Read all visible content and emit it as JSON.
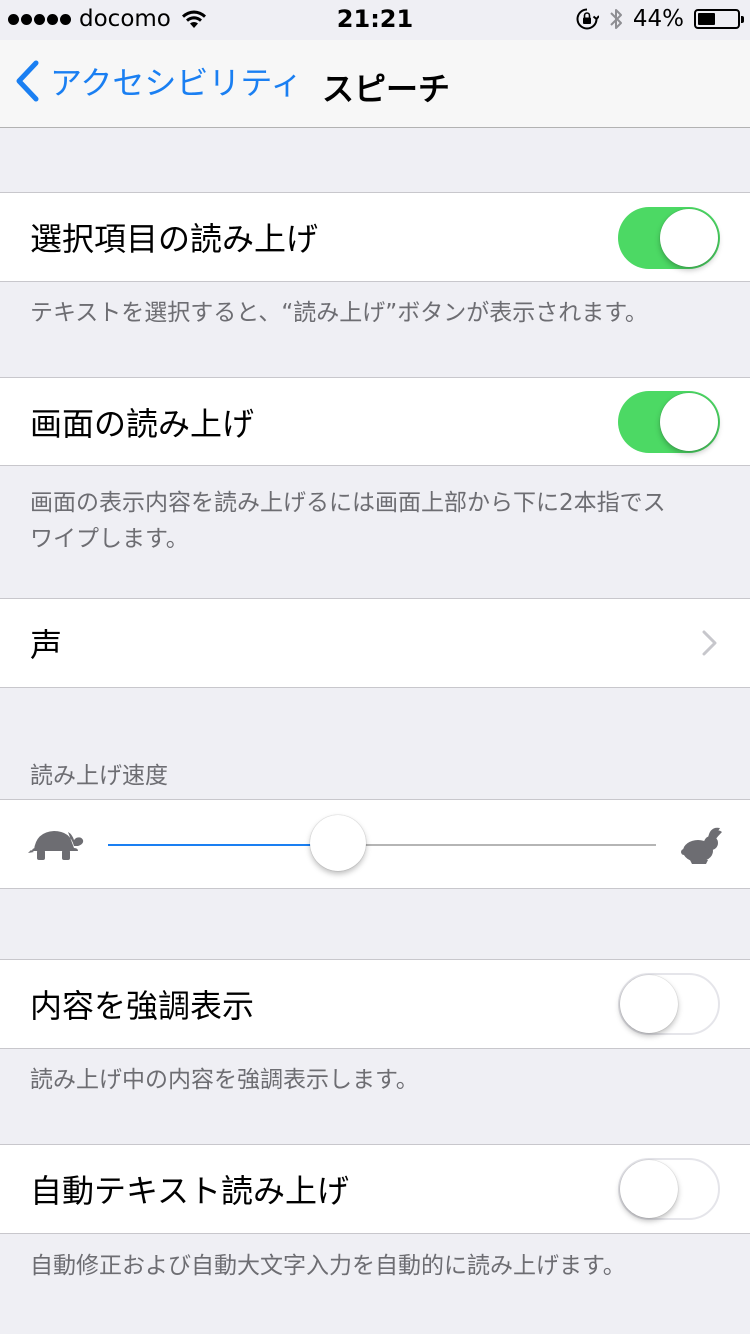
{
  "status_bar": {
    "carrier": "docomo",
    "time": "21:21",
    "battery_percent": "44%",
    "battery_level": 0.44,
    "icons": [
      "signal-dots-icon",
      "wifi-icon",
      "rotation-lock-icon",
      "bluetooth-icon",
      "battery-icon"
    ]
  },
  "nav": {
    "back_label": "アクセシビリティ",
    "title": "スピーチ"
  },
  "speak_selection": {
    "label": "選択項目の読み上げ",
    "enabled": true,
    "footer": "テキストを選択すると、“読み上げ”ボタンが表示されます。"
  },
  "speak_screen": {
    "label": "画面の読み上げ",
    "enabled": true,
    "footer_line1": "画面の表示内容を読み上げるには画面上部から下に2本指でス",
    "footer_line2": "ワイプします。"
  },
  "voice": {
    "label": "声",
    "icon": "chevron-right-icon"
  },
  "speaking_rate": {
    "header": "読み上げ速度",
    "value_fraction": 0.42,
    "min_icon": "turtle-icon",
    "max_icon": "rabbit-icon"
  },
  "highlight_content": {
    "label": "内容を強調表示",
    "enabled": false,
    "footer": "読み上げ中の内容を強調表示します。"
  },
  "typing_feedback": {
    "label": "自動テキスト読み上げ",
    "enabled": false,
    "footer": "自動修正および自動大文字入力を自動的に読み上げます。"
  },
  "colors": {
    "accent": "#1a7ff2",
    "switch_on": "#4cd964",
    "background": "#efeff4",
    "footer_text": "#6d6d72"
  }
}
